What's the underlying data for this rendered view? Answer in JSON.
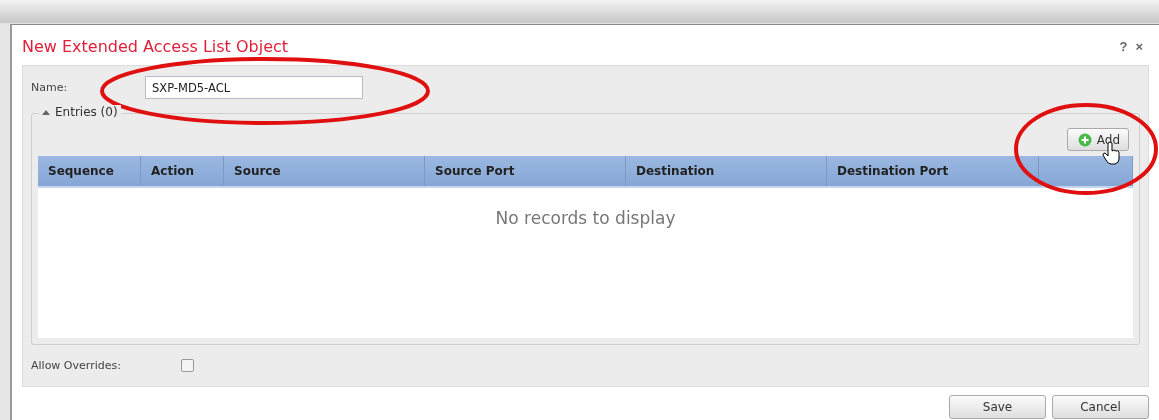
{
  "dialog": {
    "title": "New Extended Access List Object",
    "help": "?",
    "close": "×"
  },
  "name_field": {
    "label": "Name:",
    "value": "SXP-MD5-ACL"
  },
  "entries": {
    "legend": "Entries (0)",
    "expanded": true,
    "add_button": "Add",
    "columns": [
      "Sequence",
      "Action",
      "Source",
      "Source Port",
      "Destination",
      "Destination Port"
    ],
    "empty_message": "No records to display"
  },
  "allow_overrides": {
    "label": "Allow Overrides:",
    "checked": false
  },
  "buttons": [
    "Save",
    "Cancel"
  ]
}
